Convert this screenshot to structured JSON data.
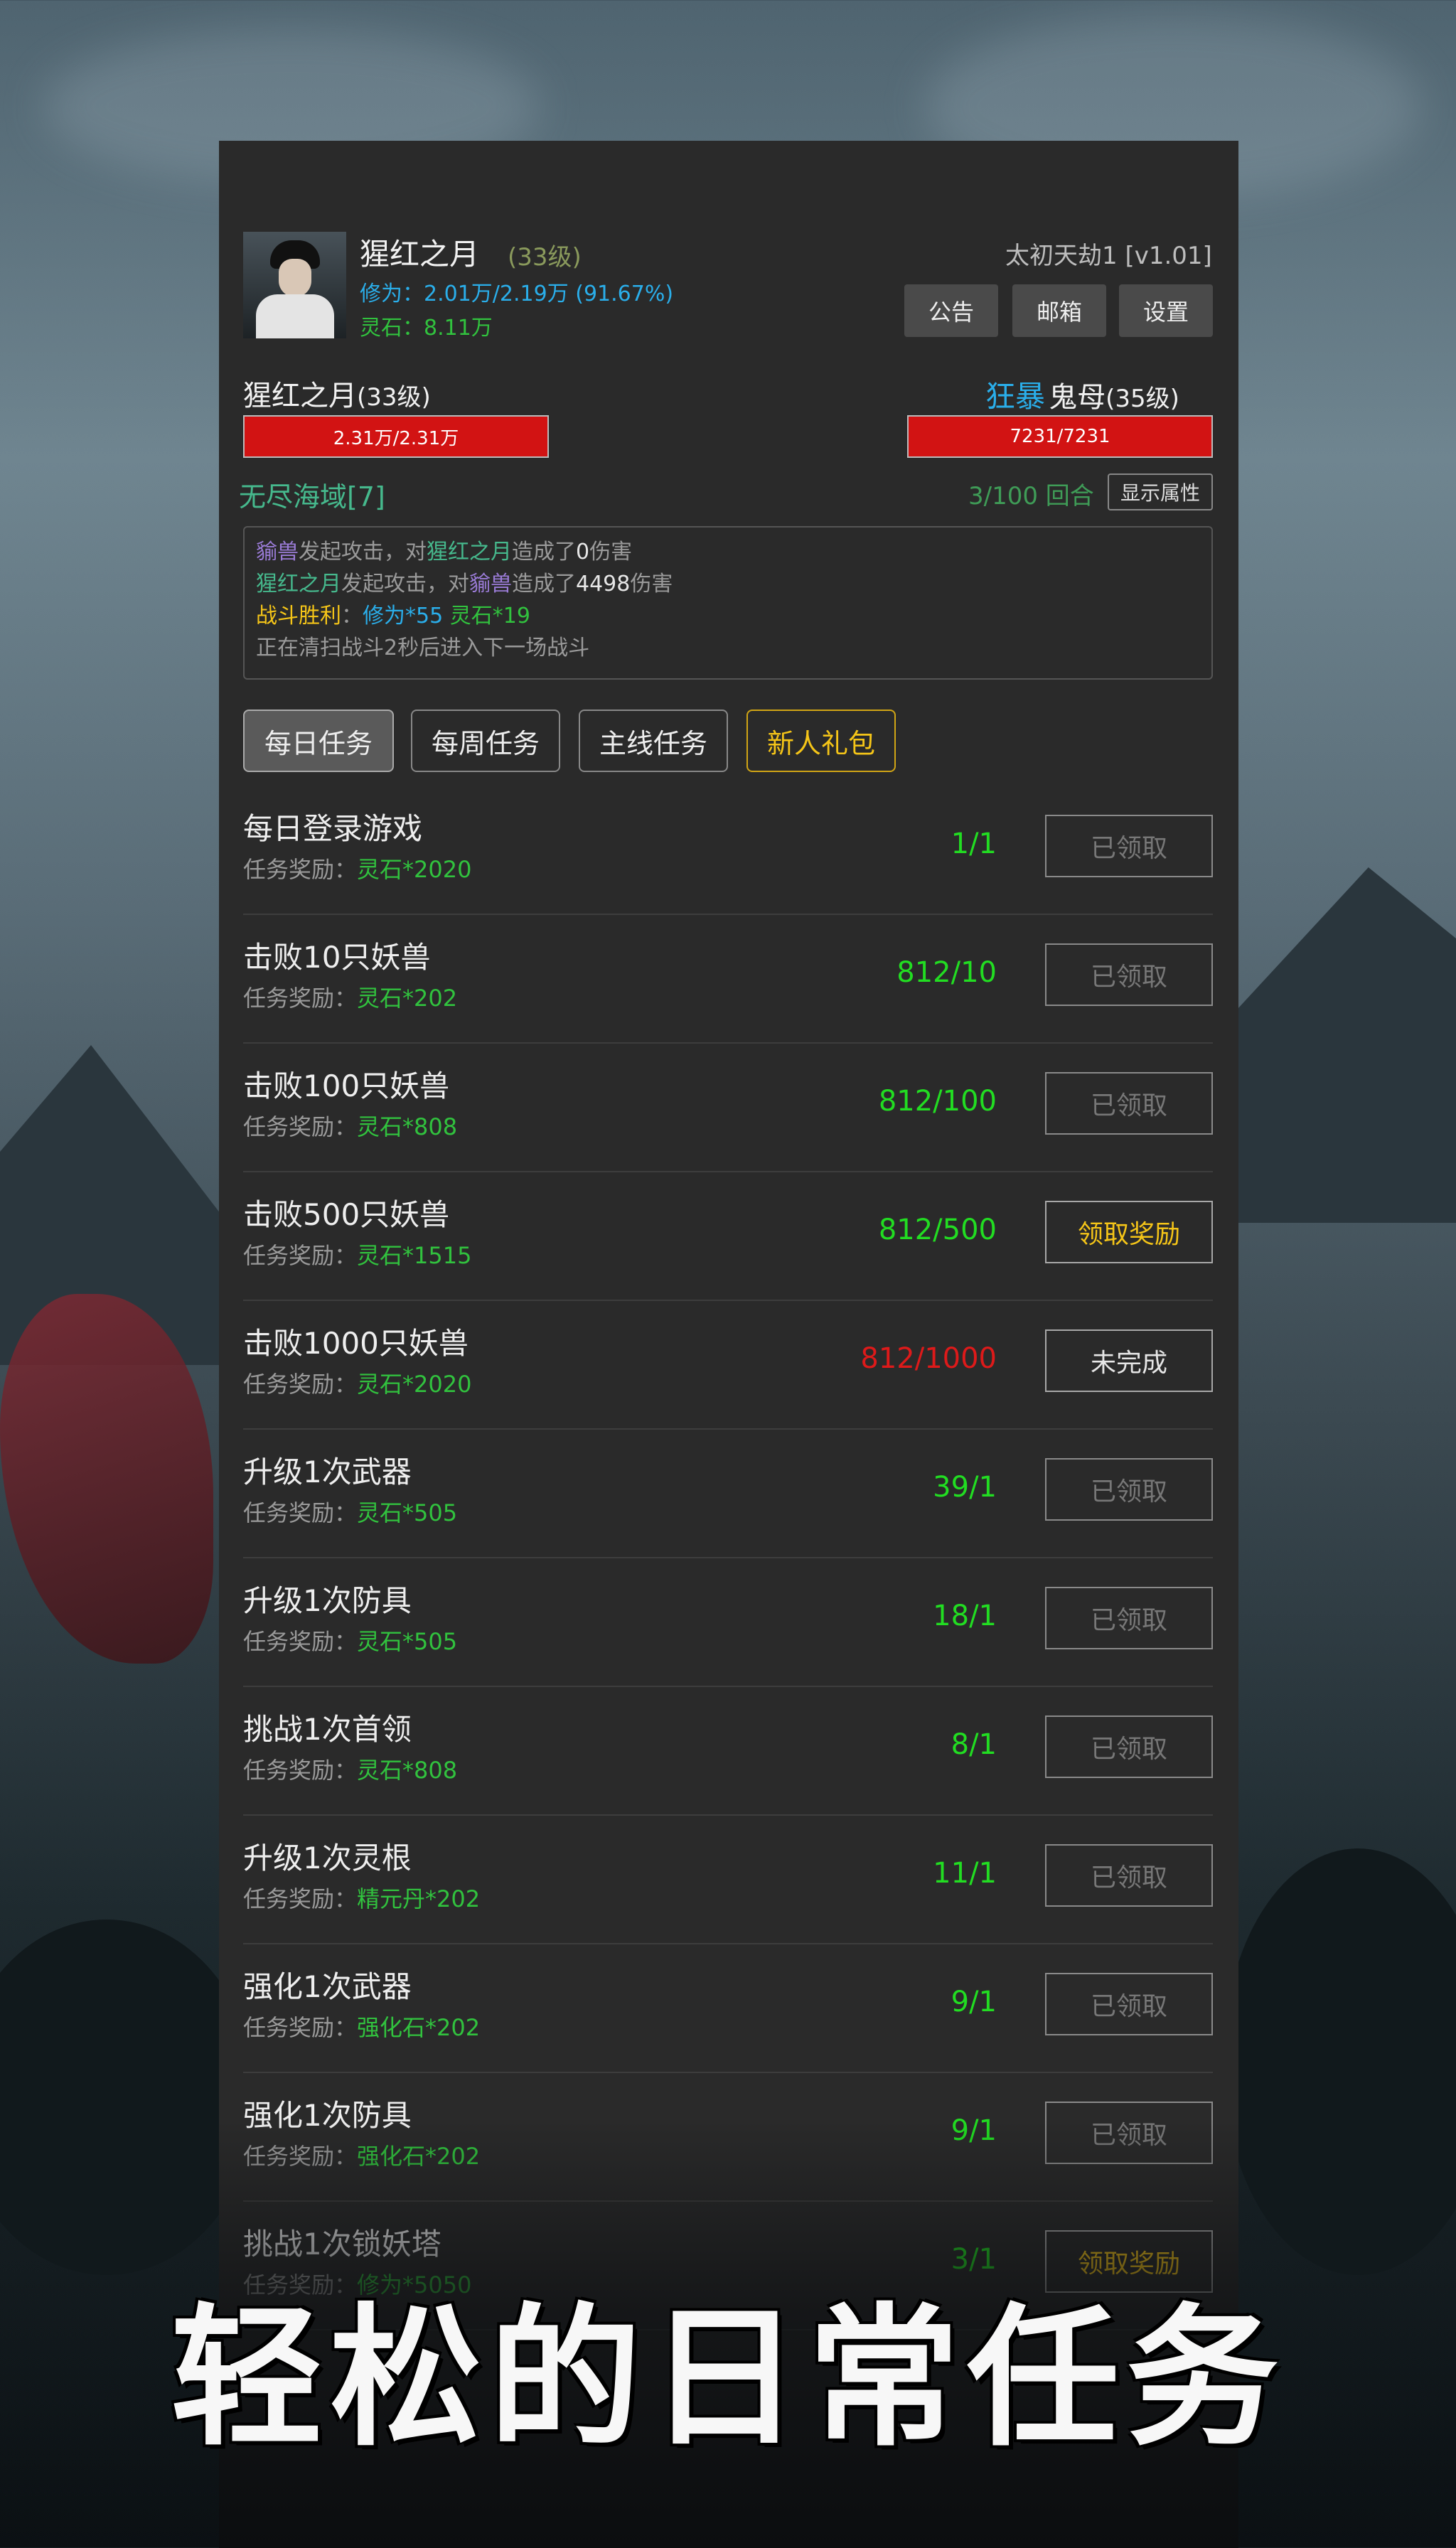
{
  "player": {
    "name": "猩红之月",
    "level": "(33级)",
    "cultivation": "修为：2.01万/2.19万 (91.67%)",
    "stones": "灵石：8.11万"
  },
  "server": "太初天劫1 [v1.01]",
  "top_buttons": {
    "notice": "公告",
    "mail": "邮箱",
    "settings": "设置"
  },
  "battle": {
    "player_name": "猩红之月",
    "player_level": "(33级)",
    "player_hp": "2.31万/2.31万",
    "enemy_tag": "狂暴",
    "enemy_name": "鬼母",
    "enemy_level": "(35级)",
    "enemy_hp": "7231/7231",
    "zone": "无尽海域[7]",
    "round": "3/100 回合",
    "show_attr": "显示属性"
  },
  "log": {
    "line1": {
      "a": "貐兽",
      "b": "发起攻击，对",
      "c": "猩红之月",
      "d": "造成了",
      "e": "0",
      "f": "伤害"
    },
    "line2": {
      "a": "猩红之月",
      "b": "发起攻击，对",
      "c": "貐兽",
      "d": "造成了",
      "e": "4498",
      "f": "伤害"
    },
    "line3": {
      "a": "战斗胜利",
      "b": "：",
      "c": "修为*55",
      "d": " ",
      "e": "灵石*19"
    },
    "line4": "正在清扫战斗2秒后进入下一场战斗"
  },
  "tabs": {
    "daily": "每日任务",
    "weekly": "每周任务",
    "main": "主线任务",
    "gift": "新人礼包"
  },
  "reward_prefix": "任务奖励：",
  "tasks": [
    {
      "title": "每日登录游戏",
      "reward": "灵石*2020",
      "progress": "1/1",
      "button": "已领取"
    },
    {
      "title": "击败10只妖兽",
      "reward": "灵石*202",
      "progress": "812/10",
      "button": "已领取"
    },
    {
      "title": "击败100只妖兽",
      "reward": "灵石*808",
      "progress": "812/100",
      "button": "已领取"
    },
    {
      "title": "击败500只妖兽",
      "reward": "灵石*1515",
      "progress": "812/500",
      "button": "领取奖励"
    },
    {
      "title": "击败1000只妖兽",
      "reward": "灵石*2020",
      "progress": "812/1000",
      "button": "未完成"
    },
    {
      "title": "升级1次武器",
      "reward": "灵石*505",
      "progress": "39/1",
      "button": "已领取"
    },
    {
      "title": "升级1次防具",
      "reward": "灵石*505",
      "progress": "18/1",
      "button": "已领取"
    },
    {
      "title": "挑战1次首领",
      "reward": "灵石*808",
      "progress": "8/1",
      "button": "已领取"
    },
    {
      "title": "升级1次灵根",
      "reward": "精元丹*202",
      "progress": "11/1",
      "button": "已领取"
    },
    {
      "title": "强化1次武器",
      "reward": "强化石*202",
      "progress": "9/1",
      "button": "已领取"
    },
    {
      "title": "强化1次防具",
      "reward": "强化石*202",
      "progress": "9/1",
      "button": "已领取"
    },
    {
      "title": "挑战1次锁妖塔",
      "reward": "修为*5050",
      "progress": "3/1",
      "button": "领取奖励"
    }
  ],
  "banner": "轻松的日常任务",
  "colors": {
    "progress_done": "#22dd22",
    "progress_incomplete": "#dd1a1a",
    "claim": "#f5c518",
    "hp": "#d21313"
  }
}
